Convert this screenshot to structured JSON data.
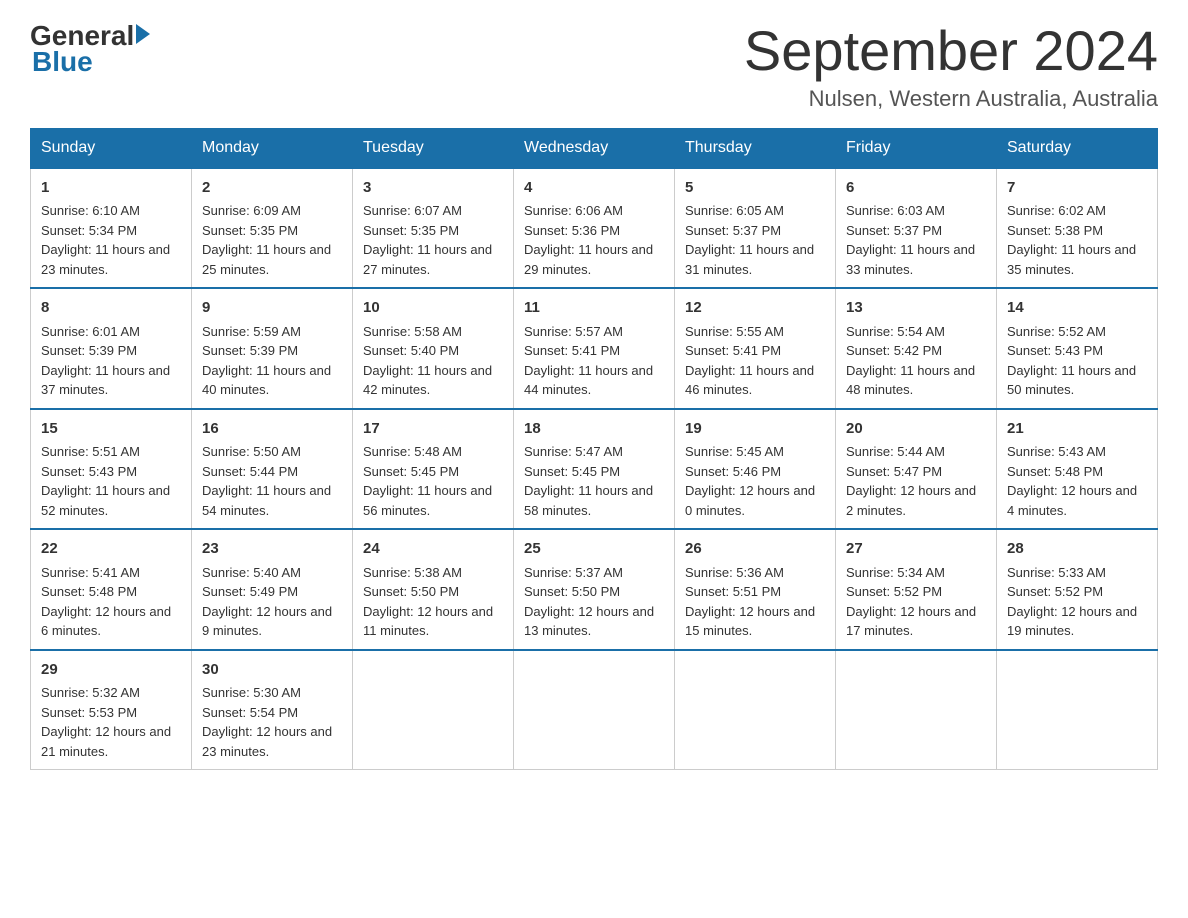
{
  "header": {
    "logo_general": "General",
    "logo_blue": "Blue",
    "month_title": "September 2024",
    "location": "Nulsen, Western Australia, Australia"
  },
  "days_of_week": [
    "Sunday",
    "Monday",
    "Tuesday",
    "Wednesday",
    "Thursday",
    "Friday",
    "Saturday"
  ],
  "weeks": [
    [
      {
        "day": "1",
        "sunrise": "6:10 AM",
        "sunset": "5:34 PM",
        "daylight": "11 hours and 23 minutes."
      },
      {
        "day": "2",
        "sunrise": "6:09 AM",
        "sunset": "5:35 PM",
        "daylight": "11 hours and 25 minutes."
      },
      {
        "day": "3",
        "sunrise": "6:07 AM",
        "sunset": "5:35 PM",
        "daylight": "11 hours and 27 minutes."
      },
      {
        "day": "4",
        "sunrise": "6:06 AM",
        "sunset": "5:36 PM",
        "daylight": "11 hours and 29 minutes."
      },
      {
        "day": "5",
        "sunrise": "6:05 AM",
        "sunset": "5:37 PM",
        "daylight": "11 hours and 31 minutes."
      },
      {
        "day": "6",
        "sunrise": "6:03 AM",
        "sunset": "5:37 PM",
        "daylight": "11 hours and 33 minutes."
      },
      {
        "day": "7",
        "sunrise": "6:02 AM",
        "sunset": "5:38 PM",
        "daylight": "11 hours and 35 minutes."
      }
    ],
    [
      {
        "day": "8",
        "sunrise": "6:01 AM",
        "sunset": "5:39 PM",
        "daylight": "11 hours and 37 minutes."
      },
      {
        "day": "9",
        "sunrise": "5:59 AM",
        "sunset": "5:39 PM",
        "daylight": "11 hours and 40 minutes."
      },
      {
        "day": "10",
        "sunrise": "5:58 AM",
        "sunset": "5:40 PM",
        "daylight": "11 hours and 42 minutes."
      },
      {
        "day": "11",
        "sunrise": "5:57 AM",
        "sunset": "5:41 PM",
        "daylight": "11 hours and 44 minutes."
      },
      {
        "day": "12",
        "sunrise": "5:55 AM",
        "sunset": "5:41 PM",
        "daylight": "11 hours and 46 minutes."
      },
      {
        "day": "13",
        "sunrise": "5:54 AM",
        "sunset": "5:42 PM",
        "daylight": "11 hours and 48 minutes."
      },
      {
        "day": "14",
        "sunrise": "5:52 AM",
        "sunset": "5:43 PM",
        "daylight": "11 hours and 50 minutes."
      }
    ],
    [
      {
        "day": "15",
        "sunrise": "5:51 AM",
        "sunset": "5:43 PM",
        "daylight": "11 hours and 52 minutes."
      },
      {
        "day": "16",
        "sunrise": "5:50 AM",
        "sunset": "5:44 PM",
        "daylight": "11 hours and 54 minutes."
      },
      {
        "day": "17",
        "sunrise": "5:48 AM",
        "sunset": "5:45 PM",
        "daylight": "11 hours and 56 minutes."
      },
      {
        "day": "18",
        "sunrise": "5:47 AM",
        "sunset": "5:45 PM",
        "daylight": "11 hours and 58 minutes."
      },
      {
        "day": "19",
        "sunrise": "5:45 AM",
        "sunset": "5:46 PM",
        "daylight": "12 hours and 0 minutes."
      },
      {
        "day": "20",
        "sunrise": "5:44 AM",
        "sunset": "5:47 PM",
        "daylight": "12 hours and 2 minutes."
      },
      {
        "day": "21",
        "sunrise": "5:43 AM",
        "sunset": "5:48 PM",
        "daylight": "12 hours and 4 minutes."
      }
    ],
    [
      {
        "day": "22",
        "sunrise": "5:41 AM",
        "sunset": "5:48 PM",
        "daylight": "12 hours and 6 minutes."
      },
      {
        "day": "23",
        "sunrise": "5:40 AM",
        "sunset": "5:49 PM",
        "daylight": "12 hours and 9 minutes."
      },
      {
        "day": "24",
        "sunrise": "5:38 AM",
        "sunset": "5:50 PM",
        "daylight": "12 hours and 11 minutes."
      },
      {
        "day": "25",
        "sunrise": "5:37 AM",
        "sunset": "5:50 PM",
        "daylight": "12 hours and 13 minutes."
      },
      {
        "day": "26",
        "sunrise": "5:36 AM",
        "sunset": "5:51 PM",
        "daylight": "12 hours and 15 minutes."
      },
      {
        "day": "27",
        "sunrise": "5:34 AM",
        "sunset": "5:52 PM",
        "daylight": "12 hours and 17 minutes."
      },
      {
        "day": "28",
        "sunrise": "5:33 AM",
        "sunset": "5:52 PM",
        "daylight": "12 hours and 19 minutes."
      }
    ],
    [
      {
        "day": "29",
        "sunrise": "5:32 AM",
        "sunset": "5:53 PM",
        "daylight": "12 hours and 21 minutes."
      },
      {
        "day": "30",
        "sunrise": "5:30 AM",
        "sunset": "5:54 PM",
        "daylight": "12 hours and 23 minutes."
      },
      null,
      null,
      null,
      null,
      null
    ]
  ]
}
